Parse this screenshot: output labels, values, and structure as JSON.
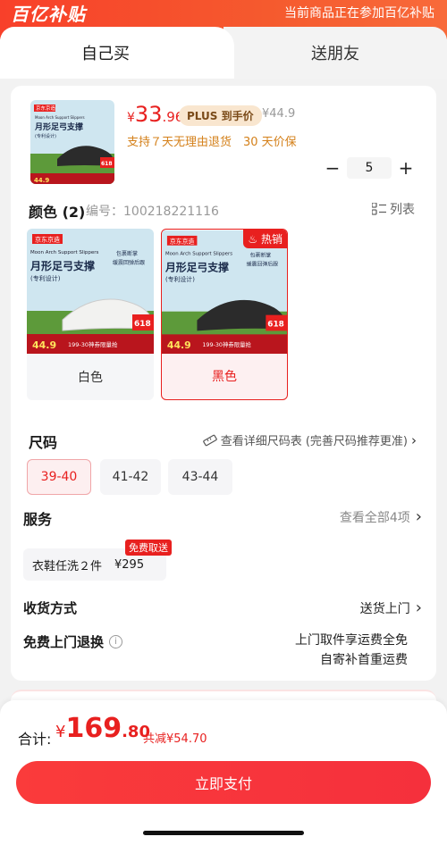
{
  "banner": {
    "logo": "百亿补贴",
    "notice": "当前商品正在参加百亿补贴"
  },
  "tabs": {
    "self": "自己买",
    "gift": "送朋友"
  },
  "product": {
    "thumb_text": {
      "brand": "京东京造",
      "en": "Moon Arch Support Slippers",
      "title": "月形足弓支撑",
      "sub": "(专利设计)",
      "tag618": "618",
      "price": "44.9"
    },
    "price_currency": "¥",
    "price_int": "33",
    "price_dec": ".96",
    "plus_label": "PLUS 到手价",
    "orig_price": "¥44.9",
    "service_line": "支持７天无理由退货　30 天价保",
    "quantity": "5",
    "minus": "−",
    "plus": "+"
  },
  "color": {
    "title": "颜色 (2)",
    "code": "编号：100218221116",
    "list_label": "列表",
    "hot_tag": "热销",
    "variants": [
      {
        "label": "白色",
        "shoe_color": "#f2f2f0"
      },
      {
        "label": "黑色",
        "shoe_color": "#2b2b2b"
      }
    ],
    "img_text": {
      "brand": "京东京造",
      "en": "Moon Arch Support Slippers",
      "title": "月形足弓支撑",
      "sub": "(专利设计)",
      "side1": "包裹断掌",
      "side2": "缓震回弹后跟",
      "tag618": "618",
      "price": "44.9",
      "promo": "199-30神券限量抢"
    }
  },
  "size": {
    "title": "尺码",
    "chart_link": "查看详细尺码表 (完善尺码推荐更准)",
    "options": [
      "39-40",
      "41-42",
      "43-44"
    ]
  },
  "service": {
    "title": "服务",
    "all_link": "查看全部4项",
    "item_name": "衣鞋任洗２件",
    "item_price": "¥295",
    "free_tag": "免费取送"
  },
  "delivery": {
    "title": "收货方式",
    "value": "送货上门"
  },
  "returns": {
    "title": "免费上门退换",
    "line1": "上门取件享运费全免",
    "line2": "自寄补首重运费"
  },
  "footer": {
    "total_label": "合计:",
    "currency": "¥",
    "total_int": "169",
    "total_dec": ".80",
    "discount": "共减¥54.70",
    "pay_button": "立即支付"
  },
  "colors": {
    "accent": "#e8201f",
    "banner": "#f8402a"
  }
}
